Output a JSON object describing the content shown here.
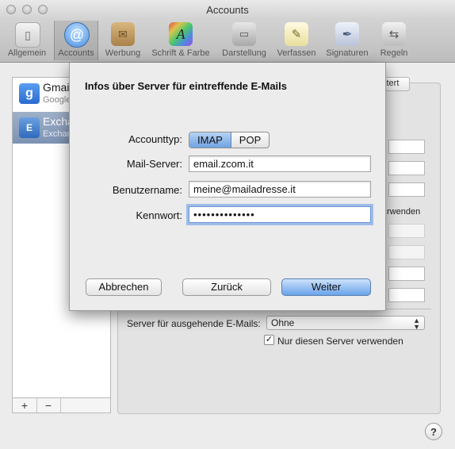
{
  "window": {
    "title": "Accounts"
  },
  "toolbar": {
    "items": [
      {
        "label": "Allgemein",
        "icon": "switch-icon"
      },
      {
        "label": "Accounts",
        "icon": "at-icon"
      },
      {
        "label": "Werbung",
        "icon": "junk-mail-icon"
      },
      {
        "label": "Schrift & Farbe",
        "icon": "font-color-icon"
      },
      {
        "label": "Darstellung",
        "icon": "viewing-icon"
      },
      {
        "label": "Verfassen",
        "icon": "compose-icon"
      },
      {
        "label": "Signaturen",
        "icon": "signature-icon"
      },
      {
        "label": "Regeln",
        "icon": "rules-icon"
      }
    ]
  },
  "accounts": [
    {
      "name": "Gmail",
      "sub": "Google"
    },
    {
      "name": "Exchange",
      "sub": "Exchange"
    }
  ],
  "background_panel": {
    "tab_partial": "Erweitert",
    "outgoing_label": "Server für ausgehende E-Mails:",
    "outgoing_value": "Ohne",
    "only_this_server_label": "Nur diesen Server verwenden",
    "verwenden_partial": "rwenden"
  },
  "dialog": {
    "title": "Infos über Server für eintreffende E-Mails",
    "account_type_label": "Accounttyp:",
    "account_type_options": [
      "IMAP",
      "POP"
    ],
    "mail_server_label": "Mail-Server:",
    "mail_server_value": "email.zcom.it",
    "username_label": "Benutzername:",
    "username_value": "meine@mailadresse.it",
    "password_label": "Kennwort:",
    "password_value": "••••••••••••••",
    "cancel_label": "Abbrechen",
    "back_label": "Zurück",
    "continue_label": "Weiter"
  },
  "sidebar_buttons": {
    "add": "+",
    "remove": "−"
  },
  "help": {
    "label": "?"
  }
}
